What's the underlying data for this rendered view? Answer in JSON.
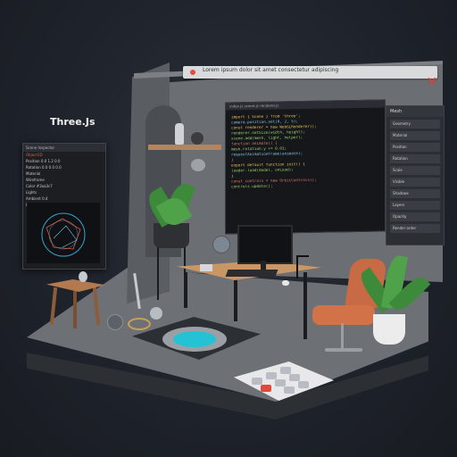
{
  "scene": {
    "label": "Three.Js",
    "window_title": "Lorem ipsum dolor sit amet consectetur adipiscing",
    "close_glyph": "✕"
  },
  "editor": {
    "tab": "index.js   scene.js   renderer.js",
    "lines": [
      {
        "t": "import { Scene } from 'three';",
        "c": "#e8c35a"
      },
      {
        "t": "  camera.position.set(0, 2, 5);",
        "c": "#7ec8e3"
      },
      {
        "t": "",
        "c": "#fff"
      },
      {
        "t": "const renderer = new WebGLRenderer();",
        "c": "#e8c35a"
      },
      {
        "t": "  renderer.setSize(width, height);",
        "c": "#9fd36a"
      },
      {
        "t": "  scene.add(mesh, light, helper);",
        "c": "#9fd36a"
      },
      {
        "t": "",
        "c": "#fff"
      },
      {
        "t": "function animate() {",
        "c": "#e07b6a"
      },
      {
        "t": "  mesh.rotation.y += 0.01;",
        "c": "#9fd36a"
      },
      {
        "t": "  requestAnimationFrame(animate);",
        "c": "#7ec8e3"
      },
      {
        "t": "}",
        "c": "#e07b6a"
      },
      {
        "t": "",
        "c": "#fff"
      },
      {
        "t": "export default function init() {",
        "c": "#e8c35a"
      },
      {
        "t": "  loader.load(model, onLoad);",
        "c": "#9fd36a"
      },
      {
        "t": "}",
        "c": "#e8c35a"
      },
      {
        "t": "",
        "c": "#fff"
      },
      {
        "t": "const controls = new OrbitControls();",
        "c": "#e07b6a"
      },
      {
        "t": "  controls.update();",
        "c": "#9fd36a"
      }
    ]
  },
  "props": {
    "header": "Mesh",
    "rows": [
      "Geometry",
      "Material",
      "Position",
      "Rotation",
      "Scale",
      "Visible",
      "Shadows",
      "Layers",
      "Opacity",
      "Render order"
    ]
  },
  "left_panel": {
    "header": "Scene Inspector",
    "rows": [
      {
        "t": "Object3D",
        "red": true
      },
      {
        "t": "Position  0.0  1.2  0.0",
        "red": false
      },
      {
        "t": "Rotation  0.0  0.0  0.0",
        "red": false
      },
      {
        "t": "Material",
        "red": false
      },
      {
        "t": "Wireframe",
        "red": false
      },
      {
        "t": "Color  #3aa3c7",
        "red": false
      },
      {
        "t": "Lights",
        "red": false
      },
      {
        "t": "Ambient  0.4",
        "red": false
      },
      {
        "t": "Directional  1.0",
        "red": false
      }
    ]
  },
  "colors": {
    "accent": "#25c2d6",
    "close": "#e53935",
    "desk": "#c99765",
    "chair": "#d27248"
  }
}
